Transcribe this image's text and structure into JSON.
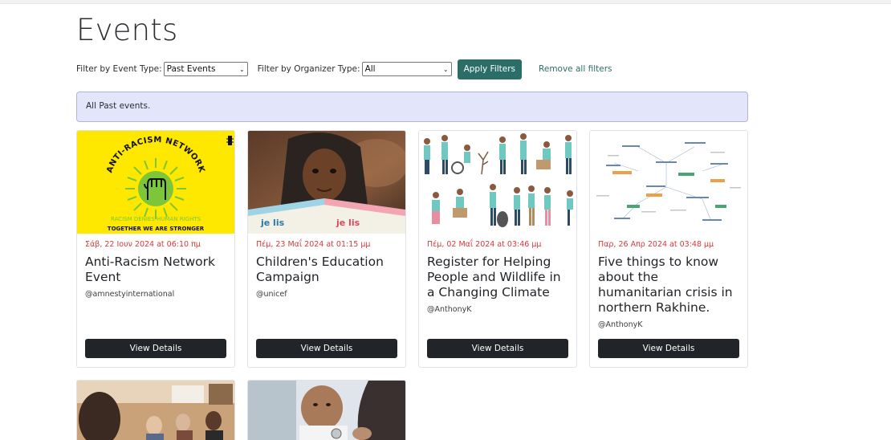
{
  "page": {
    "title": "Events"
  },
  "filters": {
    "event_type_label": "Filter by Event Type:",
    "event_type_value": "Past Events",
    "organizer_type_label": "Filter by Organizer Type:",
    "organizer_type_value": "All",
    "apply_label": "Apply Filters",
    "remove_label": "Remove all filters"
  },
  "alert": {
    "text": "All Past events."
  },
  "events": [
    {
      "date": "Σάβ, 22 Ιουν 2024 at 06:10 πμ",
      "title": "Anti-Racism Network Event",
      "organizer": "@amnestyinternational",
      "button": "View Details",
      "poster_title": "ANTI-RACISM NETWORK",
      "poster_line1": "RACISM DENIES HUMAN RIGHTS",
      "poster_line2": "TOGETHER WE ARE STRONGER"
    },
    {
      "date": "Πέμ, 23 Μαΐ 2024 at 01:15 μμ",
      "title": "Children's Education Campaign",
      "organizer": "@unicef",
      "button": "View Details"
    },
    {
      "date": "Πέμ, 02 Μαΐ 2024 at 03:46 μμ",
      "title": "Register for Helping People and Wildlife in a Changing Climate",
      "organizer": "@AnthonyK",
      "button": "View Details"
    },
    {
      "date": "Παρ, 26 Απρ 2024 at 03:48 μμ",
      "title": "Five things to know about the humanitarian crisis in northern Rakhine.",
      "organizer": "@AnthonyK",
      "button": "View Details"
    }
  ],
  "colors": {
    "accent": "#2b6e68",
    "date_red": "#d63a3a",
    "button_dark": "#212529",
    "alert_bg": "#e3e6fb",
    "poster_yellow": "#ffe800",
    "poster_green": "#7cc63a"
  },
  "icons": {
    "select_arrow": "chevron-down-icon"
  }
}
